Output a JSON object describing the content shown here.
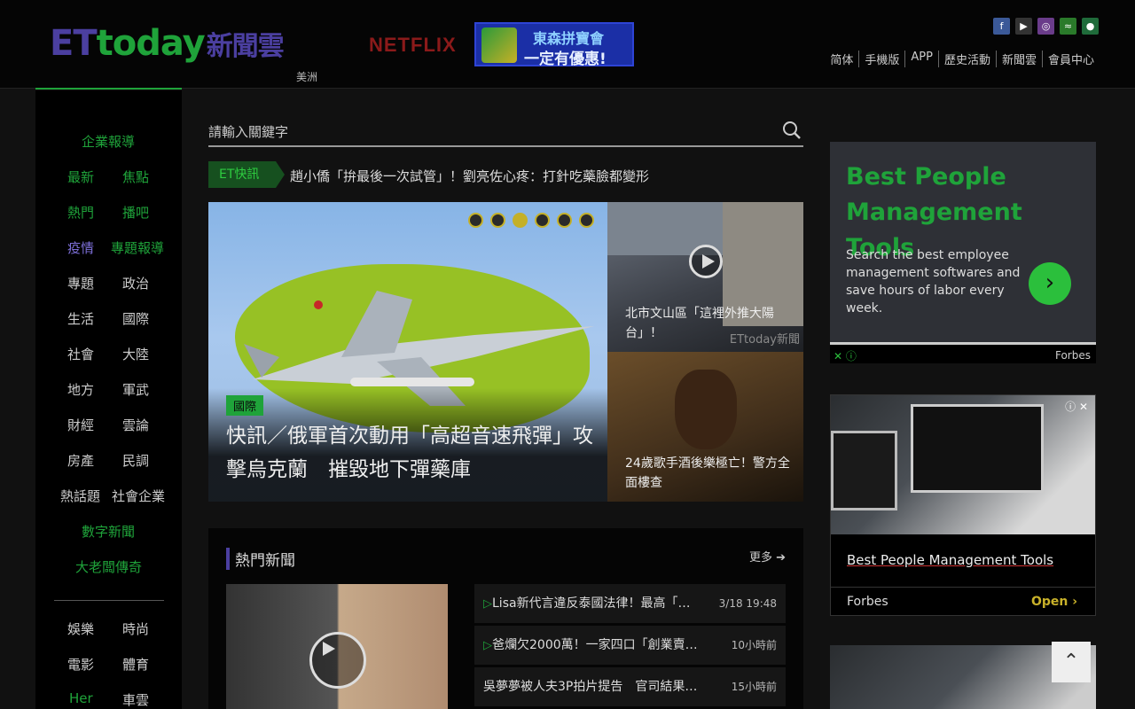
{
  "header": {
    "logo_et": "ET",
    "logo_today": "today",
    "logo_cn": "新聞雲",
    "logo_sub": "美洲",
    "sponsor": "NETFLIX",
    "banner_line1": "東森拼寶會",
    "banner_line2": "一定有優惠!",
    "social_icons": [
      "facebook-icon",
      "youtube-icon",
      "instagram-icon",
      "rss-icon",
      "line-icon"
    ],
    "toplinks": [
      "简体",
      "手機版",
      "APP",
      "歷史活動",
      "新聞雲",
      "會員中心"
    ]
  },
  "sidebar": {
    "items": [
      {
        "label": "企業報導",
        "color": "green"
      },
      {
        "label": "最新",
        "color": "green"
      },
      {
        "label": "焦點",
        "color": "green"
      },
      {
        "label": "熱門",
        "color": "green"
      },
      {
        "label": "播吧",
        "color": "green"
      },
      {
        "label": "疫情",
        "color": "purple"
      },
      {
        "label": "專題報導",
        "color": "green"
      },
      {
        "label": "專題",
        "color": "white"
      },
      {
        "label": "政治",
        "color": "white"
      },
      {
        "label": "生活",
        "color": "white"
      },
      {
        "label": "國際",
        "color": "white"
      },
      {
        "label": "社會",
        "color": "white"
      },
      {
        "label": "大陸",
        "color": "white"
      },
      {
        "label": "地方",
        "color": "white"
      },
      {
        "label": "軍武",
        "color": "white"
      },
      {
        "label": "財經",
        "color": "white"
      },
      {
        "label": "雲論",
        "color": "white"
      },
      {
        "label": "房產",
        "color": "white"
      },
      {
        "label": "民調",
        "color": "white"
      },
      {
        "label": "熱話題",
        "color": "white"
      },
      {
        "label": "社會企業",
        "color": "white"
      },
      {
        "label": "數字新聞",
        "color": "green"
      },
      {
        "label": "大老闆傳奇",
        "color": "green"
      },
      {
        "label": "娛樂",
        "color": "white"
      },
      {
        "label": "時尚",
        "color": "white"
      },
      {
        "label": "電影",
        "color": "white"
      },
      {
        "label": "體育",
        "color": "white"
      },
      {
        "label": "Her",
        "color": "green"
      },
      {
        "label": "車雲",
        "color": "white"
      }
    ]
  },
  "search": {
    "placeholder": "請輸入關鍵字"
  },
  "breaking": {
    "tag": "ET快訊",
    "text": "趙小僑「拚最後一次試管」！劉亮佐心疼：打針吃藥臉都變形"
  },
  "hero": {
    "category": "國際",
    "title": "快訊／俄軍首次動用「高超音速飛彈」攻擊烏克蘭　摧毀地下彈藥庫",
    "active_dot": 3,
    "dot_count": 6
  },
  "side_news": [
    {
      "title": "北市文山區「這裡外推大陽台」！",
      "watermark": "ETtoday新聞"
    },
    {
      "title": "24歲歌手酒後樂極亡！警方全面樓查"
    }
  ],
  "hot": {
    "heading": "熱門新聞",
    "more": "更多",
    "items": [
      {
        "title": "Lisa新代言違反泰國法律！最高「…",
        "time": "3/18 19:48",
        "video": true
      },
      {
        "title": "爸爛欠2000萬！一家四口「創業賣…",
        "time": "10小時前",
        "video": true
      },
      {
        "title": "吳夢夢被人夫3P拍片提告　官司結果…",
        "time": "15小時前",
        "video": false
      }
    ]
  },
  "ads": {
    "ad1_headline_1": "Best People",
    "ad1_headline_2": "Management Tools",
    "ad1_desc": "Search the best employee management softwares and save hours of labor every week.",
    "ad1_brand": "Forbes",
    "ad2_link": "Best People Management Tools",
    "ad2_brand": "Forbes",
    "ad2_open": "Open"
  }
}
